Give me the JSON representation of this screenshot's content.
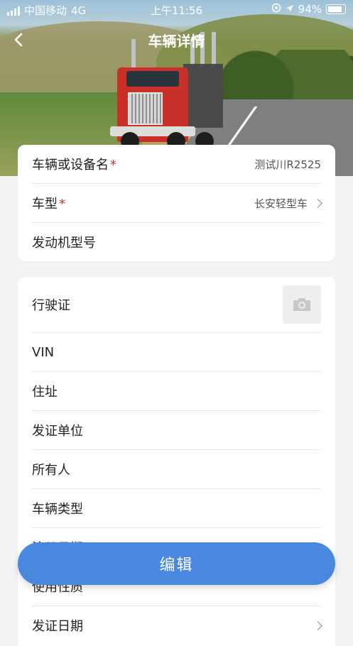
{
  "status_bar": {
    "carrier": "中国移动",
    "network": "4G",
    "time": "上午11:56",
    "battery": "94%"
  },
  "nav": {
    "title": "车辆详情"
  },
  "basic_info": [
    {
      "label": "车辆或设备名",
      "required": true,
      "value": "测试川R2525"
    },
    {
      "label": "车型",
      "required": true,
      "value": "长安轻型车"
    },
    {
      "label": "发动机型号",
      "required": false,
      "value": ""
    }
  ],
  "license_info": {
    "driving_license_label": "行驶证",
    "rows": [
      {
        "label": "VIN"
      },
      {
        "label": "住址"
      },
      {
        "label": "发证单位"
      },
      {
        "label": "所有人"
      },
      {
        "label": "车辆类型"
      },
      {
        "label": "注册日期"
      },
      {
        "label": "使用性质"
      },
      {
        "label": "发证日期"
      }
    ]
  },
  "actions": {
    "edit_label": "编辑"
  },
  "colors": {
    "primary": "#4a88e0",
    "required_star": "#e12f2f"
  }
}
